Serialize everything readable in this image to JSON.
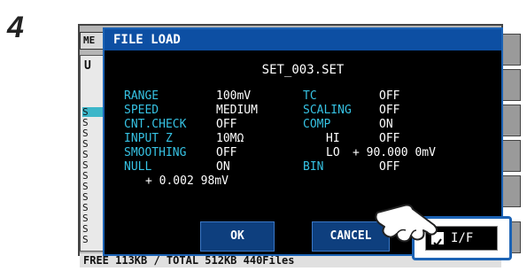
{
  "step_number": "4",
  "background": {
    "tab_label": "ME",
    "list_header": "U",
    "list_items": [
      "S",
      "S",
      "S",
      "S",
      "S",
      "S",
      "S",
      "S",
      "S",
      "S",
      "S",
      "S",
      "S",
      "S",
      "S",
      "S"
    ],
    "footer_text": "FREE  113KB / TOTAL  512KB 440Files"
  },
  "dialog": {
    "title": "FILE LOAD",
    "filename": "SET_003.SET",
    "left_settings": [
      {
        "label": "RANGE",
        "value": "100mV"
      },
      {
        "label": "SPEED",
        "value": "MEDIUM"
      },
      {
        "label": "CNT.CHECK",
        "value": "OFF"
      },
      {
        "label": "INPUT Z",
        "value": "10MΩ"
      },
      {
        "label": "SMOOTHING",
        "value": "OFF"
      },
      {
        "label": "NULL",
        "value": "ON"
      }
    ],
    "null_offset": "+   0.002 98mV",
    "right_settings": [
      {
        "label": "TC",
        "value": "OFF"
      },
      {
        "label": "SCALING",
        "value": "OFF"
      },
      {
        "label": "COMP",
        "value": "ON"
      },
      {
        "label": "HI",
        "value": "OFF"
      },
      {
        "label": "LO",
        "value": "+  90.000 0mV"
      },
      {
        "label": "BIN",
        "value": "OFF"
      }
    ],
    "ok_label": "OK",
    "cancel_label": "CANCEL",
    "if_label": "I/F",
    "if_checked": true
  },
  "colors": {
    "dialog_title_bg": "#0d4fa3",
    "label_cyan": "#36c2e3",
    "button_blue": "#0e3f7e",
    "highlight_border": "#1c63b5"
  },
  "icons": [
    "pointing-hand-icon",
    "checkbox-checked-icon"
  ]
}
